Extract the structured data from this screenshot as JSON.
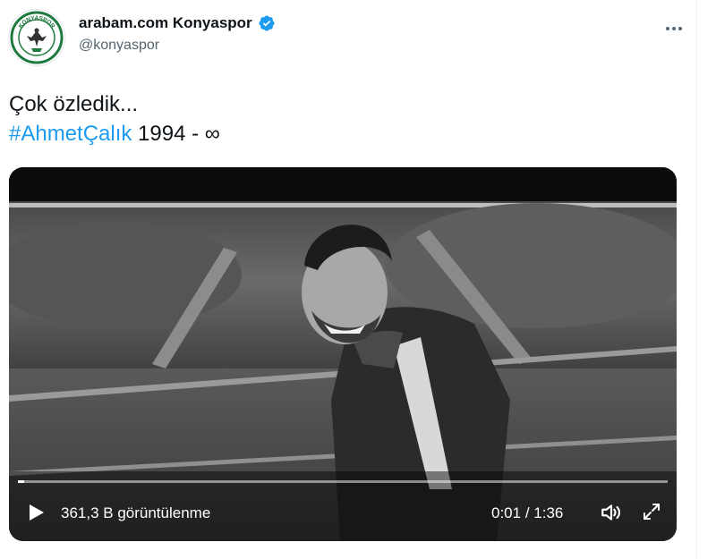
{
  "account": {
    "display_name": "arabam.com Konyaspor",
    "handle": "@konyaspor",
    "avatar_text": "KONYASPOR",
    "verified": true
  },
  "tweet": {
    "line1": "Çok özledik...",
    "hashtag": "#AhmetÇalık",
    "years": " 1994 - ∞"
  },
  "video": {
    "view_count": "361,3 B",
    "view_label": " görüntülenme",
    "current_time": "0:01",
    "duration": "1:36",
    "time_separator": " / ",
    "progress": 0.01
  },
  "icons": {
    "more": "more-horizontal-icon",
    "verified": "verified-badge-icon",
    "play": "play-icon",
    "volume": "volume-icon",
    "fullscreen": "fullscreen-icon"
  },
  "colors": {
    "accent": "#1d9bf0",
    "text": "#0f1419",
    "secondary_text": "#536471",
    "avatar_green": "#1f7a3f"
  }
}
